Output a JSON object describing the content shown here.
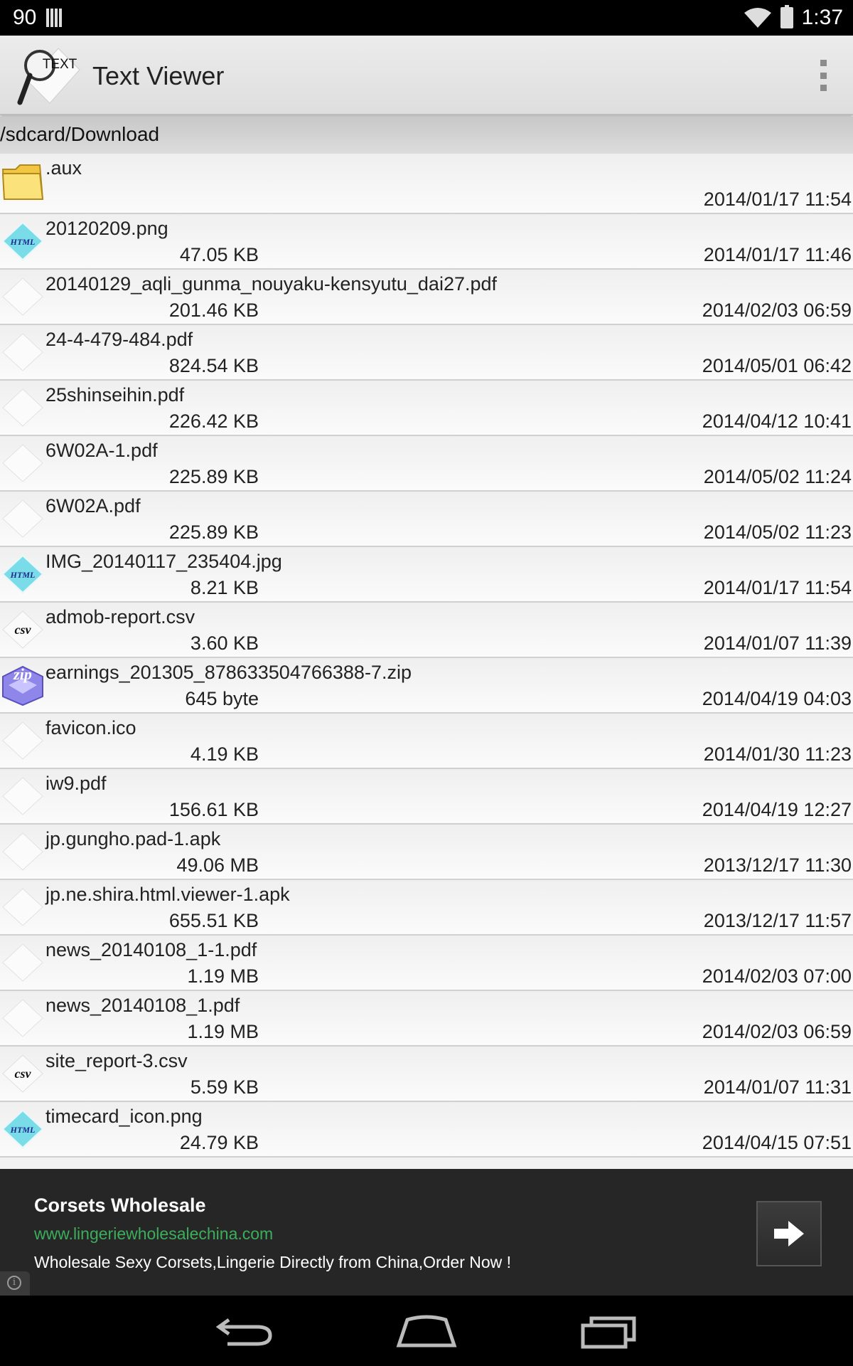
{
  "status_bar": {
    "notification": "90",
    "time": "1:37"
  },
  "app": {
    "title": "Text Viewer",
    "logo_text": "TEXT"
  },
  "path": "/sdcard/Download",
  "files": [
    {
      "name": ".aux",
      "size": "",
      "date": "2014/01/17 11:54",
      "icon": "folder-icon"
    },
    {
      "name": "20120209.png",
      "size": "47.05 KB",
      "date": "2014/01/17 11:46",
      "icon": "html-icon"
    },
    {
      "name": "20140129_aqli_gunma_nouyaku-kensyutu_dai27.pdf",
      "size": "201.46 KB",
      "date": "2014/02/03 06:59",
      "icon": "blank-file-icon"
    },
    {
      "name": "24-4-479-484.pdf",
      "size": "824.54 KB",
      "date": "2014/05/01 06:42",
      "icon": "blank-file-icon"
    },
    {
      "name": "25shinseihin.pdf",
      "size": "226.42 KB",
      "date": "2014/04/12 10:41",
      "icon": "blank-file-icon"
    },
    {
      "name": "6W02A-1.pdf",
      "size": "225.89 KB",
      "date": "2014/05/02 11:24",
      "icon": "blank-file-icon"
    },
    {
      "name": "6W02A.pdf",
      "size": "225.89 KB",
      "date": "2014/05/02 11:23",
      "icon": "blank-file-icon"
    },
    {
      "name": "IMG_20140117_235404.jpg",
      "size": "8.21 KB",
      "date": "2014/01/17 11:54",
      "icon": "html-icon"
    },
    {
      "name": "admob-report.csv",
      "size": "3.60 KB",
      "date": "2014/01/07 11:39",
      "icon": "csv-icon"
    },
    {
      "name": "earnings_201305_878633504766388-7.zip",
      "size": "645 byte",
      "date": "2014/04/19 04:03",
      "icon": "zip-icon"
    },
    {
      "name": "favicon.ico",
      "size": "4.19 KB",
      "date": "2014/01/30 11:23",
      "icon": "blank-file-icon"
    },
    {
      "name": "iw9.pdf",
      "size": "156.61 KB",
      "date": "2014/04/19 12:27",
      "icon": "blank-file-icon"
    },
    {
      "name": "jp.gungho.pad-1.apk",
      "size": "49.06 MB",
      "date": "2013/12/17 11:30",
      "icon": "blank-file-icon"
    },
    {
      "name": "jp.ne.shira.html.viewer-1.apk",
      "size": "655.51 KB",
      "date": "2013/12/17 11:57",
      "icon": "blank-file-icon"
    },
    {
      "name": "news_20140108_1-1.pdf",
      "size": "1.19 MB",
      "date": "2014/02/03 07:00",
      "icon": "blank-file-icon"
    },
    {
      "name": "news_20140108_1.pdf",
      "size": "1.19 MB",
      "date": "2014/02/03 06:59",
      "icon": "blank-file-icon"
    },
    {
      "name": "site_report-3.csv",
      "size": "5.59 KB",
      "date": "2014/01/07 11:31",
      "icon": "csv-icon"
    },
    {
      "name": "timecard_icon.png",
      "size": "24.79 KB",
      "date": "2014/04/15 07:51",
      "icon": "html-icon"
    }
  ],
  "ad": {
    "title": "Corsets Wholesale",
    "url": "www.lingeriewholesalechina.com",
    "description": "Wholesale Sexy Corsets,Lingerie Directly from China,Order Now !",
    "info_glyph": "i"
  },
  "colors": {
    "ad_url": "#3cae5b",
    "status_bar": "#000000",
    "ad_background": "#262626"
  }
}
